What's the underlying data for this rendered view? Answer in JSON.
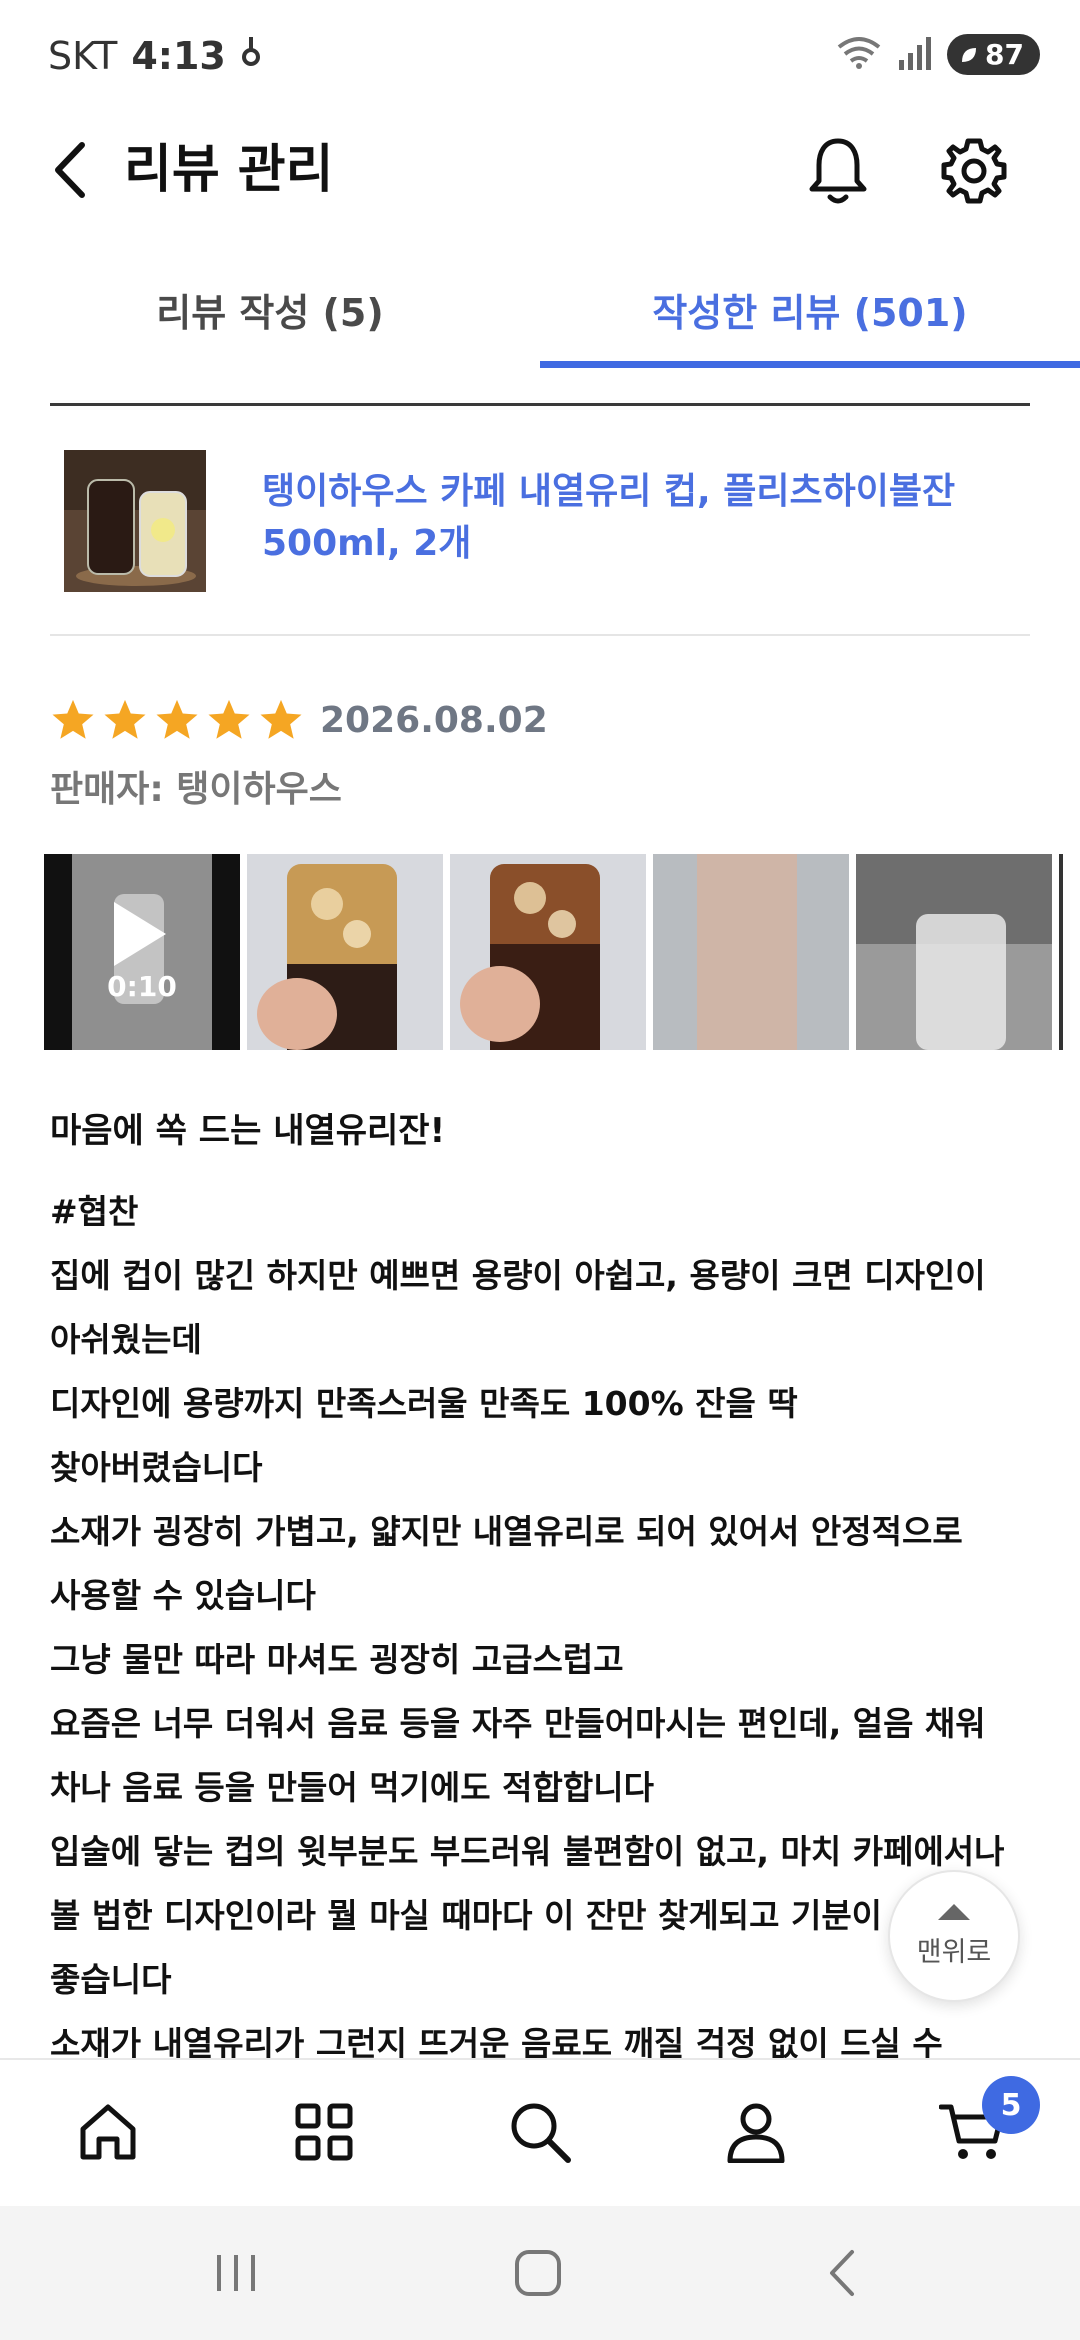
{
  "status_bar": {
    "carrier": "SKT",
    "time": "4:13",
    "battery": "87"
  },
  "header": {
    "title": "리뷰 관리"
  },
  "tabs": [
    {
      "label": "리뷰 작성 (5)",
      "active": false
    },
    {
      "label": "작성한 리뷰 (501)",
      "active": true
    }
  ],
  "product": {
    "name_line1": "탱이하우스 카페 내열유리 컵, 플리츠하이볼잔",
    "name_line2": "500ml, 2개"
  },
  "review": {
    "rating": 5,
    "date": "2026.08.02",
    "seller": "판매자: 탱이하우스",
    "media": [
      {
        "type": "video",
        "duration": "0:10"
      },
      {
        "type": "photo"
      },
      {
        "type": "photo"
      },
      {
        "type": "photo"
      },
      {
        "type": "photo"
      }
    ],
    "title": "마음에 쏙 드는 내열유리잔!",
    "lines": [
      "#협찬",
      "집에 컵이 많긴 하지만 예쁘면 용량이 아쉽고, 용량이 크면 디자인이",
      "아쉬웠는데",
      "디자인에 용량까지 만족스러울 만족도 100% 잔을 딱",
      "찾아버렸습니다",
      "소재가 굉장히 가볍고, 얇지만 내열유리로 되어 있어서 안정적으로",
      "사용할 수 있습니다",
      "그냥 물만 따라 마셔도 굉장히 고급스럽고",
      "요즘은 너무 더워서 음료 등을 자주 만들어마시는 편인데, 얼음 채워",
      "차나 음료 등을 만들어 먹기에도 적합합니다",
      "입술에 닿는 컵의 윗부분도 부드러워 불편함이 없고, 마치 카페에서나",
      "볼 법한 디자인이라 뭘 마실 때마다 이 잔만 찾게되고 기분이",
      "좋습니다",
      "소재가 내열유리가 그런지 뜨거운 음료도 깨질 걱정 없이 드실 수"
    ]
  },
  "scroll_top": {
    "label": "맨위로"
  },
  "bottom_nav": {
    "items": [
      "home-icon",
      "category-icon",
      "search-icon",
      "profile-icon",
      "cart-icon"
    ],
    "cart_count": "5"
  },
  "colors": {
    "accent": "#3f6ae2",
    "star": "#f5a623"
  }
}
